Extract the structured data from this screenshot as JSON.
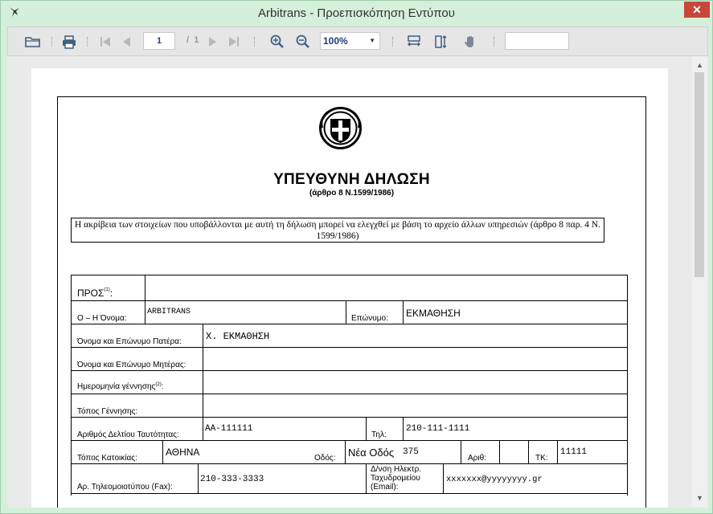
{
  "window": {
    "title": "Arbitrans - Προεπισκόπηση Εντύπου",
    "close_glyph": "✕"
  },
  "toolbar": {
    "page_current": "1",
    "page_separator": "/",
    "page_total": "1",
    "zoom_value": "100%",
    "search_value": "",
    "icons": [
      "open-folder-icon",
      "print-icon",
      "first-page-icon",
      "previous-page-icon",
      "next-page-icon",
      "last-page-icon",
      "zoom-in-icon",
      "zoom-out-icon",
      "fit-width-icon",
      "fit-page-icon",
      "hand-tool-icon"
    ]
  },
  "document": {
    "title": "ΥΠΕΥΘΥΝΗ ΔΗΛΩΣΗ",
    "subtitle": "(άρθρο 8 Ν.1599/1986)",
    "notice": "Η ακρίβεια των στοιχείων που υποβάλλονται με αυτή τη δήλωση μπορεί να ελεγχθεί με βάση το αρχείο άλλων υπηρεσιών (άρθρο 8 παρ. 4 Ν. 1599/1986)",
    "form": {
      "pros_label": "ΠΡΟΣ",
      "pros_sup": "(1)",
      "pros_colon": ":",
      "name_label": "Ο – Η Όνομα:",
      "name_value": "ARBITRANS",
      "surname_label": "Επώνυμο:",
      "surname_value": "ΕΚΜΑΘΗΣΗ",
      "father_label": "Όνομα και Επώνυμο Πατέρα:",
      "father_value": "Χ. ΕΚΜΑΘΗΣΗ",
      "mother_label": "Όνομα και Επώνυμο Μητέρας:",
      "mother_value": "",
      "birthdate_label": "Ημερομηνία γέννησης",
      "birthdate_sup": "(2)",
      "birthdate_colon": ":",
      "birthplace_label": "Τόπος Γέννησης:",
      "id_label": "Αριθμός Δελτίου Ταυτότητας:",
      "id_value": "ΑΑ-111111",
      "phone_label": "Τηλ:",
      "phone_value": "210-111-1111",
      "residence_label": "Τόπος Κατοικίας:",
      "residence_value": "ΑΘΗΝΑ",
      "street_label": "Οδός:",
      "street_value": "Νέα Οδός",
      "street_number_value": "375",
      "number_label": "Αριθ:",
      "postcode_label": "ΤΚ:",
      "postcode_value": "11111",
      "fax_label": "Αρ. Τηλεομοιοτύπου (Fax):",
      "fax_value": "210-333-3333",
      "email_label_1": "Δ/νση Ηλεκτρ.",
      "email_label_2": "Ταχυδρομείου",
      "email_label_3": "(Email):",
      "email_value": "xxxxxxx@yyyyyyyy.gr"
    }
  }
}
